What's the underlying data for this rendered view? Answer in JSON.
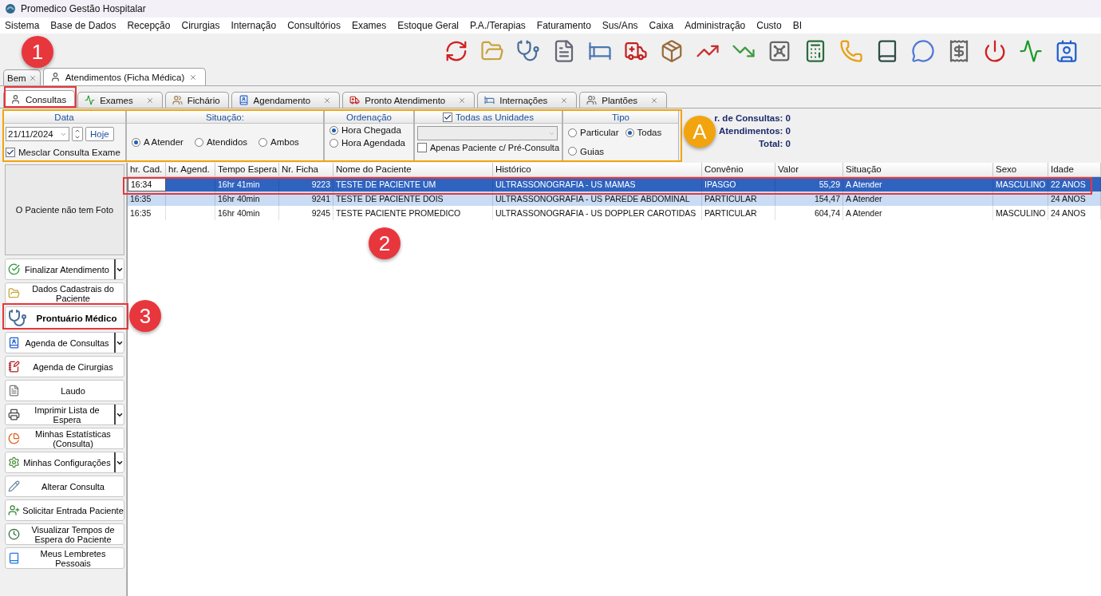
{
  "window": {
    "title": "Promedico Gestão Hospitalar"
  },
  "menu": [
    "Sistema",
    "Base de Dados",
    "Recepção",
    "Cirurgias",
    "Internação",
    "Consultórios",
    "Exames",
    "Estoque Geral",
    "P.A./Terapias",
    "Faturamento",
    "Sus/Ans",
    "Caixa",
    "Administração",
    "Custo",
    "BI"
  ],
  "top_tabs": [
    {
      "label": "Bem",
      "selected": false
    },
    {
      "label": "Atendimentos (Ficha Médica)",
      "selected": true
    }
  ],
  "sub_tabs": [
    {
      "label": "Consultas",
      "selected": true,
      "closable": false
    },
    {
      "label": "Exames",
      "selected": false,
      "closable": true
    },
    {
      "label": "Fichário",
      "selected": false,
      "closable": false
    },
    {
      "label": "Agendamento",
      "selected": false,
      "closable": true
    },
    {
      "label": "Pronto Atendimento",
      "selected": false,
      "closable": true
    },
    {
      "label": "Internações",
      "selected": false,
      "closable": true
    },
    {
      "label": "Plantões",
      "selected": false,
      "closable": true
    }
  ],
  "filters": {
    "date": {
      "title": "Data",
      "value": "21/11/2024",
      "today_button": "Hoje",
      "merge": {
        "label": "Mesclar Consulta Exame",
        "checked": true
      }
    },
    "situacao": {
      "title": "Situação:",
      "options": [
        {
          "label": "A Atender",
          "selected": true
        },
        {
          "label": "Atendidos",
          "selected": false
        },
        {
          "label": "Ambos",
          "selected": false
        }
      ]
    },
    "ordenacao": {
      "title": "Ordenação",
      "options": [
        {
          "label": "Hora Chegada",
          "selected": true
        },
        {
          "label": "Hora Agendada",
          "selected": false
        }
      ]
    },
    "unidades": {
      "all": {
        "label": "Todas as Unidades",
        "checked": true
      },
      "pre_consulta": {
        "label": "Apenas Paciente c/ Pré-Consulta",
        "checked": false
      }
    },
    "tipo": {
      "title": "Tipo",
      "options": [
        {
          "label": "Particular",
          "selected": false
        },
        {
          "label": "Todas",
          "selected": true
        },
        {
          "label": "Guias",
          "selected": false
        }
      ]
    }
  },
  "counts": [
    "r. de Consultas: 0",
    "Atendimentos: 0",
    "Total: 0"
  ],
  "photo_text": "O Paciente não tem Foto",
  "actions": [
    {
      "label": "Finalizar Atendimento",
      "kind": "normal",
      "menu": true
    },
    {
      "label": "Dados Cadastrais do Paciente",
      "kind": "normal",
      "menu": false
    },
    {
      "label": "Prontuário Médico",
      "kind": "primary",
      "menu": false
    },
    {
      "label": "Agenda de Consultas",
      "kind": "normal",
      "menu": true
    },
    {
      "label": "Agenda de Cirurgias",
      "kind": "normal",
      "menu": false
    },
    {
      "label": "Laudo",
      "kind": "normal",
      "menu": false
    },
    {
      "label": "Imprimir Lista de Espera",
      "kind": "normal",
      "menu": true
    },
    {
      "label": "Minhas Estatísticas (Consulta)",
      "kind": "normal",
      "menu": false
    },
    {
      "label": "Minhas Configurações",
      "kind": "normal",
      "menu": true
    },
    {
      "label": "Alterar Consulta",
      "kind": "normal",
      "menu": false
    },
    {
      "label": "Solicitar Entrada Paciente",
      "kind": "normal",
      "menu": false
    },
    {
      "label": "Visualizar Tempos de Espera do Paciente",
      "kind": "normal",
      "menu": false
    },
    {
      "label": "Meus Lembretes Pessoais",
      "kind": "normal",
      "menu": false
    }
  ],
  "table": {
    "columns": [
      "hr. Cad.",
      "hr. Agend.",
      "Tempo Espera",
      "Nr. Ficha",
      "Nome do Paciente",
      "Histórico",
      "Convênio",
      "Valor",
      "Situação",
      "Sexo",
      "Idade"
    ],
    "rows": [
      {
        "selected": true,
        "highlighted": false,
        "cells": [
          "16:34",
          "",
          "16hr 41min",
          "9223",
          "TESTE DE PACIENTE UM",
          "ULTRASSONOGRAFIA - US MAMAS",
          "IPASGO",
          "55,29",
          "A Atender",
          "MASCULINO",
          "22 ANOS"
        ]
      },
      {
        "selected": false,
        "highlighted": true,
        "cells": [
          "16:35",
          "",
          "16hr 40min",
          "9241",
          "TESTE DE PACIENTE DOIS",
          "ULTRASSONOGRAFIA - US PAREDE ABDOMINAL",
          "PARTICULAR",
          "154,47",
          "A Atender",
          "",
          "24 ANOS"
        ]
      },
      {
        "selected": false,
        "highlighted": false,
        "cells": [
          "16:35",
          "",
          "16hr 40min",
          "9245",
          "TESTE PACIENTE PROMEDICO",
          "ULTRASSONOGRAFIA - US DOPPLER CAROTIDAS",
          "PARTICULAR",
          "604,74",
          "A Atender",
          "MASCULINO",
          "24 ANOS"
        ]
      }
    ]
  },
  "annotations": [
    {
      "label": "1",
      "kind": "step"
    },
    {
      "label": "A",
      "kind": "group"
    },
    {
      "label": "2",
      "kind": "step"
    },
    {
      "label": "3",
      "kind": "step"
    }
  ]
}
